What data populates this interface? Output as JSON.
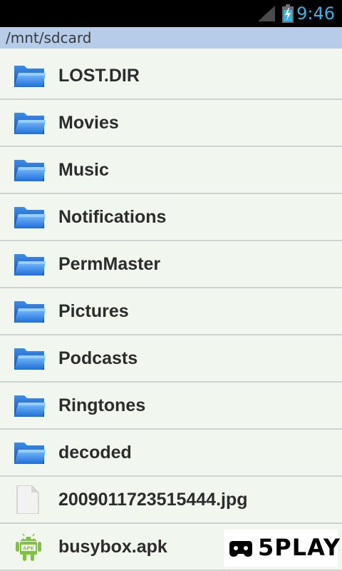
{
  "status_bar": {
    "time": "9:46",
    "signal_icon": "signal-icon",
    "battery_icon": "battery-charging-icon",
    "clock_color": "#33b5e5"
  },
  "path_bar": {
    "path": "/mnt/sdcard",
    "background": "#b6cce9"
  },
  "files": [
    {
      "name": "LOST.DIR",
      "type": "folder",
      "icon": "folder-icon"
    },
    {
      "name": "Movies",
      "type": "folder",
      "icon": "folder-icon"
    },
    {
      "name": "Music",
      "type": "folder",
      "icon": "folder-icon"
    },
    {
      "name": "Notifications",
      "type": "folder",
      "icon": "folder-icon"
    },
    {
      "name": "PermMaster",
      "type": "folder",
      "icon": "folder-icon"
    },
    {
      "name": "Pictures",
      "type": "folder",
      "icon": "folder-icon"
    },
    {
      "name": "Podcasts",
      "type": "folder",
      "icon": "folder-icon"
    },
    {
      "name": "Ringtones",
      "type": "folder",
      "icon": "folder-icon"
    },
    {
      "name": "decoded",
      "type": "folder",
      "icon": "folder-icon"
    },
    {
      "name": "2009011723515444.jpg",
      "type": "file",
      "icon": "file-icon"
    },
    {
      "name": "busybox.apk",
      "type": "apk",
      "icon": "android-apk-icon"
    }
  ],
  "watermark": {
    "text": "5PLAY",
    "icon": "gamepad-logo-icon"
  }
}
